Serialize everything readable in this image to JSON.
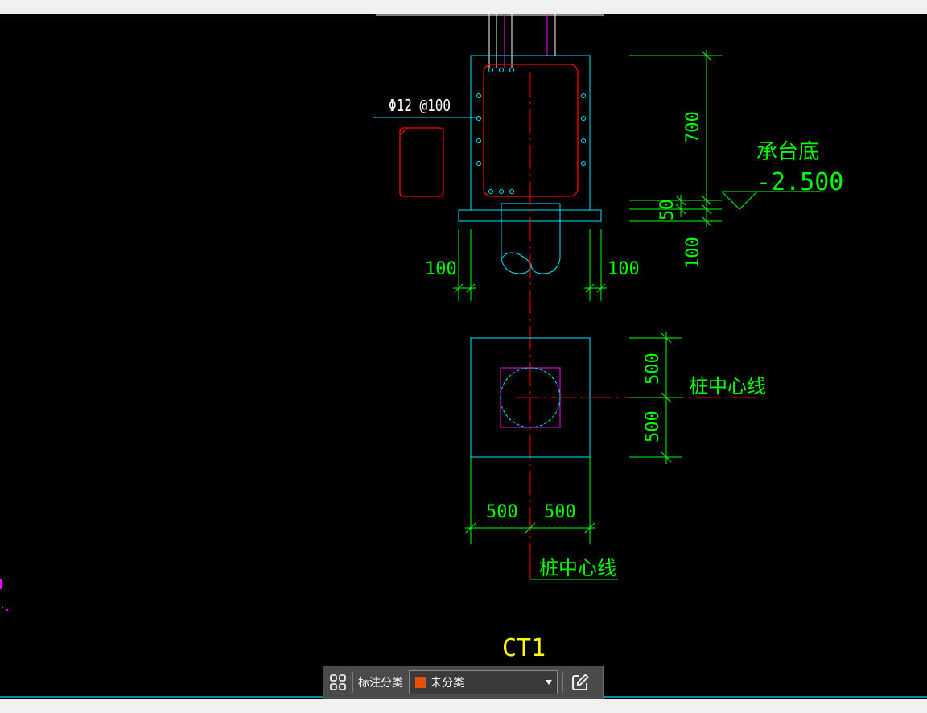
{
  "drawing": {
    "rebar_label": "Φ12 @100",
    "dim_700": "700",
    "dim_50": "50",
    "dim_100_right": "100",
    "dim_100_left": "100",
    "dim_100_side": "100",
    "elevation_label": "承台底",
    "elevation_value": "-2.500",
    "dim_500_top": "500",
    "dim_500_bottom": "500",
    "dim_500_left": "500",
    "dim_500_right": "500",
    "pile_center_label_right": "桩中心线",
    "pile_center_label_bottom": "桩中心线",
    "title_label": "CT1"
  },
  "toolbar": {
    "label": "标注分类",
    "category_value": "未分类",
    "swatch_color": "#e8500a"
  },
  "colors": {
    "cyan": "#00e5ff",
    "green": "#00ff00",
    "red": "#ff0000",
    "magenta": "#ff00ff",
    "white": "#ffffff",
    "yellow": "#ffff00"
  }
}
